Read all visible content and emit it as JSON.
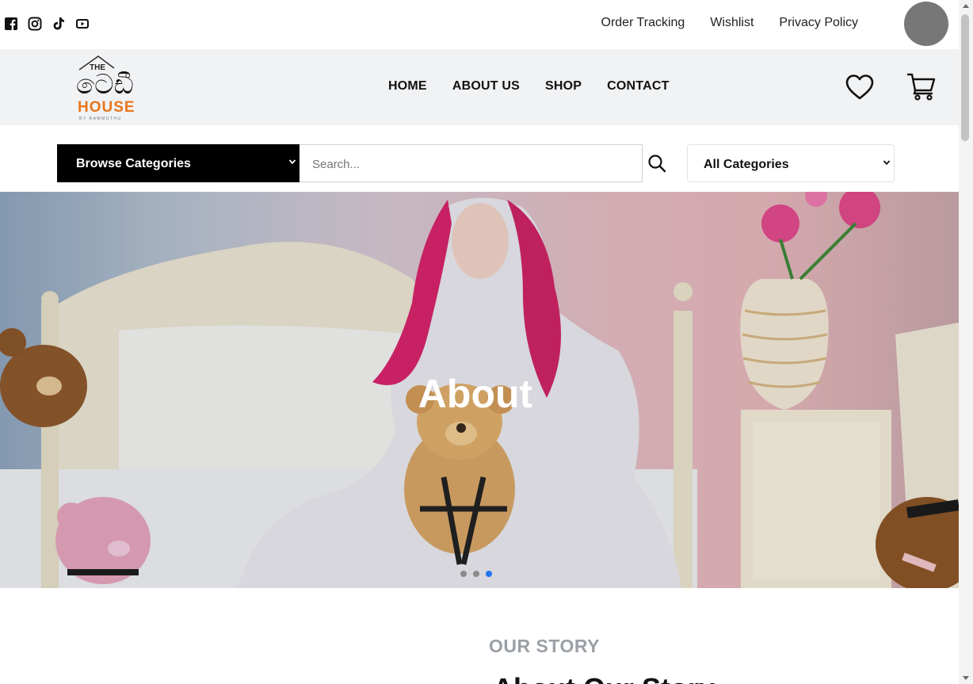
{
  "topbar": {
    "social_icons": [
      "facebook-icon",
      "instagram-icon",
      "tiktok-icon",
      "youtube-icon"
    ],
    "links": [
      "Order Tracking",
      "Wishlist",
      "Privacy Policy"
    ]
  },
  "header": {
    "logo": {
      "line1": "THE",
      "line2": "ටෙඩී",
      "line3": "HOUSE",
      "line4": "BY RAMMUTHU"
    },
    "nav": [
      "HOME",
      "ABOUT US",
      "SHOP",
      "CONTACT"
    ],
    "icons": [
      "heart-icon",
      "cart-icon"
    ]
  },
  "search": {
    "browse_label": "Browse Categories",
    "placeholder": "Search...",
    "category_label": "All Categories"
  },
  "hero": {
    "title": "About",
    "slides_total": 3,
    "active_slide": 3
  },
  "story": {
    "label": "OUR STORY",
    "title": "About Our Story"
  },
  "colors": {
    "accent_blue": "#1e74f0",
    "logo_orange": "#e8761c",
    "header_bg": "#f1f2f4"
  }
}
